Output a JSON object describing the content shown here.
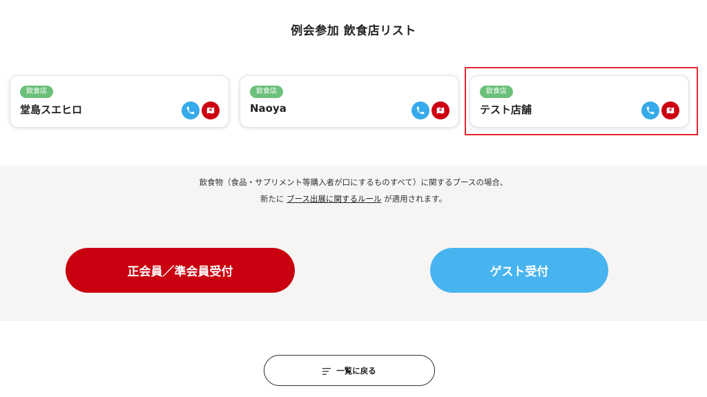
{
  "page": {
    "title": "例会参加 飲食店リスト"
  },
  "stores": [
    {
      "category": "飲食店",
      "name": "堂島スエヒロ"
    },
    {
      "category": "飲食店",
      "name": "Naoya"
    },
    {
      "category": "飲食店",
      "name": "テスト店舗"
    }
  ],
  "icons": {
    "phone": "phone-icon",
    "map": "map-icon",
    "menu": "list-icon"
  },
  "notice": {
    "line1": "飲食物（食品・サプリメント等購入者が口にするものすべて）に関するブースの場合、",
    "line2_prefix": "新たに ",
    "line2_link": "ブース出展に関するルール",
    "line2_suffix": " が適用されます。"
  },
  "buttons": {
    "member": "正会員／準会員受付",
    "guest": "ゲスト受付",
    "back": "一覧に戻る"
  },
  "colors": {
    "badge": "#6cc07a",
    "phone": "#36aaea",
    "map": "#cc0011",
    "member": "#c8000f",
    "guest": "#48b4ef",
    "highlight": "#e3242b"
  }
}
